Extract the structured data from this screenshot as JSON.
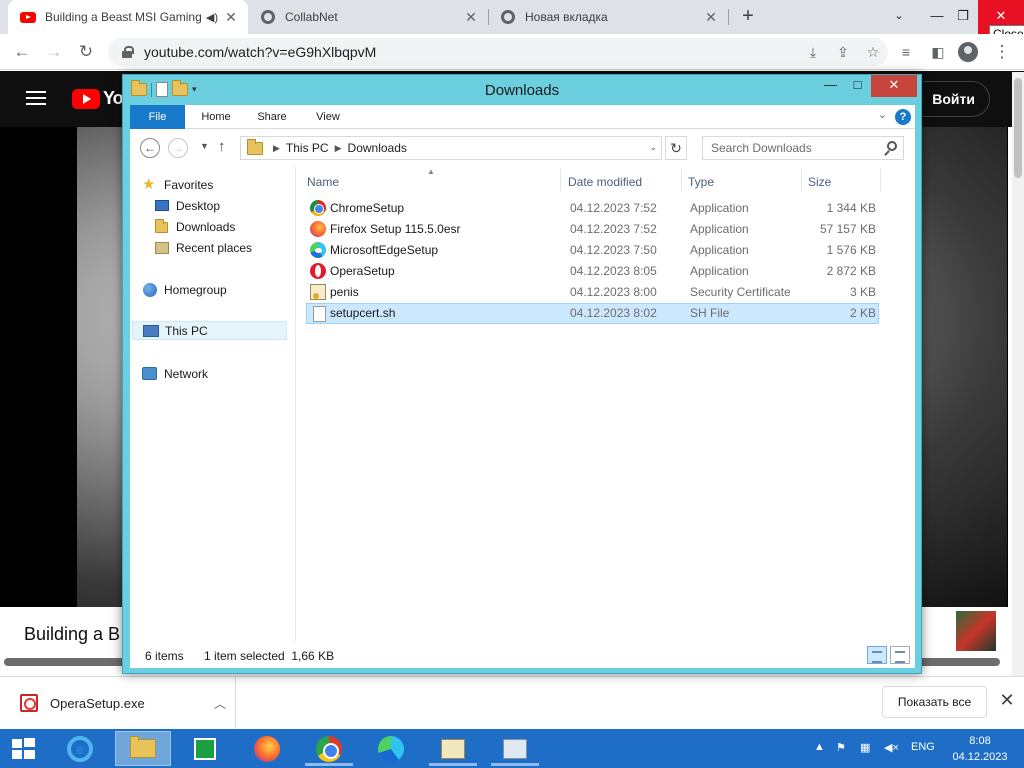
{
  "browser": {
    "tabs": [
      {
        "title": "Building a Beast MSI Gaming",
        "close": "✕"
      },
      {
        "title": "CollabNet",
        "close": "✕"
      },
      {
        "title": "Новая вкладка",
        "close": "✕"
      }
    ],
    "new_tab": "+",
    "tooltip": "Close",
    "url": "youtube.com/watch?v=eG9hXlbqpvM"
  },
  "youtube": {
    "logo_text": "Yo",
    "signin_label": "Войти",
    "video_title": "Building a B"
  },
  "downloads_bar": {
    "file_name": "OperaSetup.exe",
    "show_all_label": "Показать все"
  },
  "explorer": {
    "title": "Downloads",
    "ribbon_tabs": [
      "File",
      "Home",
      "Share",
      "View"
    ],
    "breadcrumb": [
      "This PC",
      "Downloads"
    ],
    "search_placeholder": "Search Downloads",
    "nav": {
      "favorites": "Favorites",
      "desktop": "Desktop",
      "downloads": "Downloads",
      "recent": "Recent places",
      "homegroup": "Homegroup",
      "this_pc": "This PC",
      "network": "Network"
    },
    "columns": {
      "name": "Name",
      "date": "Date modified",
      "type": "Type",
      "size": "Size"
    },
    "files": [
      {
        "name": "ChromeSetup",
        "date": "04.12.2023 7:52",
        "type": "Application",
        "size": "1 344 KB",
        "icon": "chrome-icon"
      },
      {
        "name": "Firefox Setup 115.5.0esr",
        "date": "04.12.2023 7:52",
        "type": "Application",
        "size": "57 157 KB",
        "icon": "firefox-icon"
      },
      {
        "name": "MicrosoftEdgeSetup",
        "date": "04.12.2023 7:50",
        "type": "Application",
        "size": "1 576 KB",
        "icon": "edge-icon"
      },
      {
        "name": "OperaSetup",
        "date": "04.12.2023 8:05",
        "type": "Application",
        "size": "2 872 KB",
        "icon": "opera-icon"
      },
      {
        "name": "penis",
        "date": "04.12.2023 8:00",
        "type": "Security Certificate",
        "size": "3 KB",
        "icon": "certificate-icon"
      },
      {
        "name": "setupcert.sh",
        "date": "04.12.2023 8:02",
        "type": "SH File",
        "size": "2 KB",
        "icon": "file-icon"
      }
    ],
    "selected_row": 5,
    "status": {
      "count": "6 items",
      "selection": "1 item selected  1,66 KB"
    }
  },
  "taskbar": {
    "language": "ENG",
    "time": "8:08",
    "date": "04.12.2023"
  },
  "colors": {
    "explorer_frame": "#6ccfe0",
    "ribbon_file_tab": "#1979ca",
    "selection": "#cce8ff",
    "taskbar": "#1e6ec8",
    "chrome_close": "#e81123"
  }
}
